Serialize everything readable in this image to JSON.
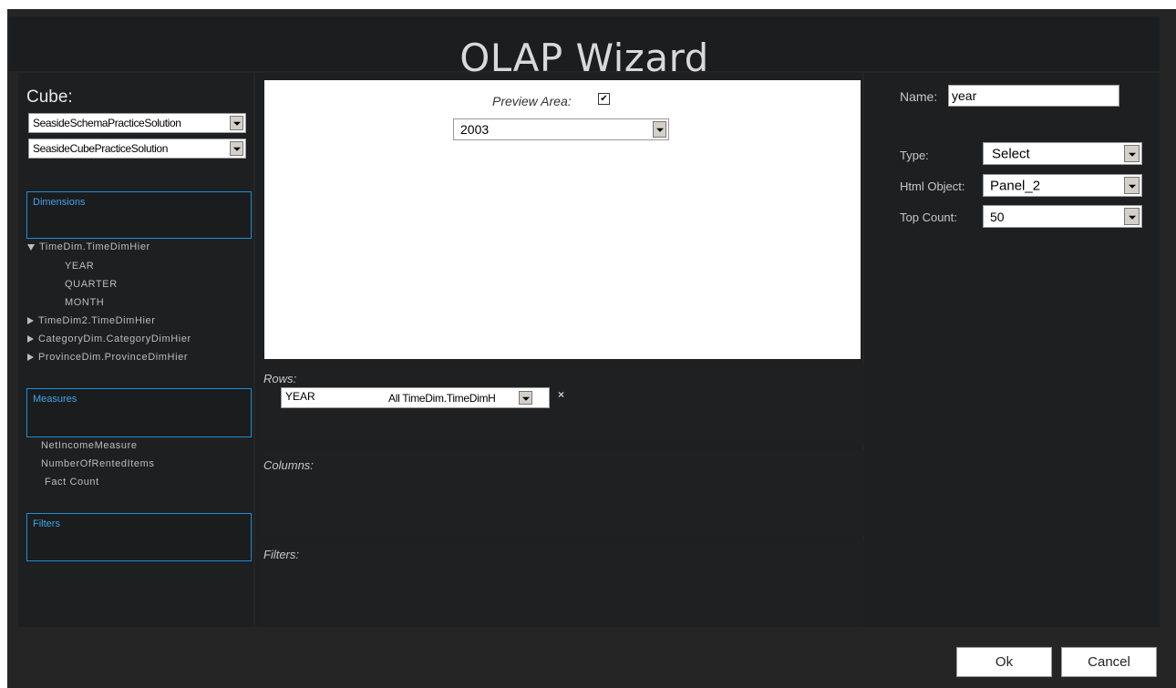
{
  "window": {
    "title": "OLAP Wizard"
  },
  "cube": {
    "label": "Cube:",
    "schema_selected": "SeasideSchemaPracticeSolution",
    "cube_selected": "SeasideCubePracticeSolution"
  },
  "dimensions": {
    "label": "Dimensions",
    "tree": [
      {
        "label": "TimeDim.TimeDimHier",
        "expanded": true
      },
      {
        "label": "YEAR"
      },
      {
        "label": "QUARTER"
      },
      {
        "label": "MONTH"
      },
      {
        "label": "TimeDim2.TimeDimHier",
        "expanded": false
      },
      {
        "label": "CategoryDim.CategoryDimHier",
        "expanded": false
      },
      {
        "label": "ProvinceDim.ProvinceDimHier",
        "expanded": false
      }
    ]
  },
  "measures": {
    "label": "Measures",
    "items": [
      "NetIncomeMeasure",
      "NumberOfRentedItems",
      "Fact Count"
    ]
  },
  "filters_box": {
    "label": "Filters"
  },
  "preview": {
    "label": "Preview Area:",
    "checked": true,
    "checkmark": "✔",
    "select_value": "2003"
  },
  "rows": {
    "label": "Rows:",
    "field": "YEAR",
    "hierarchy": "All TimeDim.TimeDimH",
    "remove": "×"
  },
  "columns": {
    "label": "Columns:"
  },
  "filters_area": {
    "label": "Filters:"
  },
  "properties": {
    "name_label": "Name:",
    "name_value": "year",
    "type_label": "Type:",
    "type_value": "Select",
    "html_object_label": "Html Object:",
    "html_object_value": "Panel_2",
    "top_count_label": "Top Count:",
    "top_count_value": "50"
  },
  "buttons": {
    "ok": "Ok",
    "cancel": "Cancel"
  },
  "colors": {
    "accent": "#1e8ed6",
    "background": "#252525"
  }
}
